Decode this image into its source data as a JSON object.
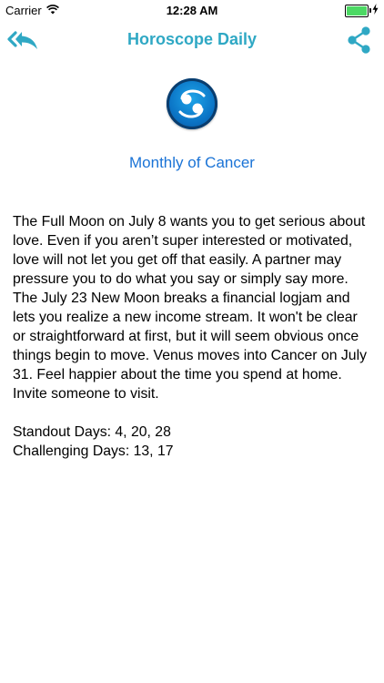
{
  "status_bar": {
    "carrier": "Carrier",
    "time": "12:28 AM",
    "battery_level": 1.0,
    "icons": [
      "wifi-icon",
      "battery-icon",
      "charging-bolt-icon"
    ]
  },
  "nav": {
    "title": "Horoscope Daily",
    "back_icon": "reply-all-back-icon",
    "share_icon": "share-icon",
    "accent_color": "#2fa8c4"
  },
  "sign": {
    "icon": "cancer-zodiac-icon"
  },
  "content": {
    "subtitle": "Monthly of Cancer",
    "body": "The Full Moon on July 8 wants you to get serious about love. Even if you aren’t super interested or motivated, love will not let you get off that easily. A partner may pressure you to do what you say or simply say more. The July 23 New Moon breaks a financial logjam and lets you realize a new income stream. It won't be clear or straightforward at first, but it will seem obvious once things begin to move. Venus moves into Cancer on July 31. Feel happier about the time you spend at home. Invite someone to visit.",
    "standout_days": "Standout Days: 4, 20, 28",
    "challenging_days": "Challenging Days: 13, 17"
  }
}
